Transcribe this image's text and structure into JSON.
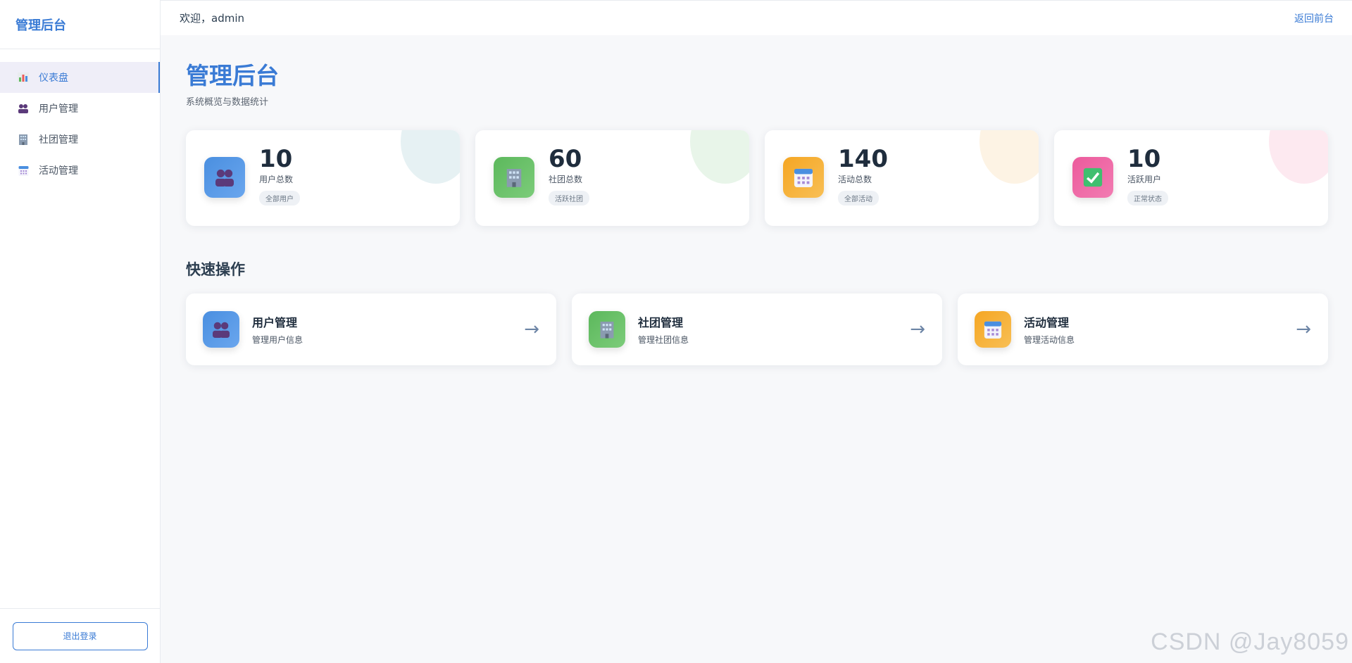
{
  "sidebar": {
    "brand": "管理后台",
    "items": [
      {
        "label": "仪表盘",
        "icon": "bar-chart-icon"
      },
      {
        "label": "用户管理",
        "icon": "users-icon"
      },
      {
        "label": "社团管理",
        "icon": "building-icon"
      },
      {
        "label": "活动管理",
        "icon": "calendar-icon"
      }
    ],
    "logout_label": "退出登录"
  },
  "topbar": {
    "welcome": "欢迎，admin",
    "back_link": "返回前台"
  },
  "main": {
    "title": "管理后台",
    "subtitle": "系统概览与数据统计",
    "stats": [
      {
        "value": "10",
        "label": "用户总数",
        "badge": "全部用户",
        "icon": "users-icon",
        "color": "#4a8fe0",
        "blob": "#e6f1f3"
      },
      {
        "value": "60",
        "label": "社团总数",
        "badge": "活跃社团",
        "icon": "building-icon",
        "color": "#5cb85c",
        "blob": "#e8f5e9"
      },
      {
        "value": "140",
        "label": "活动总数",
        "badge": "全部活动",
        "icon": "calendar-icon",
        "color": "#f5a623",
        "blob": "#fdf3e4"
      },
      {
        "value": "10",
        "label": "活跃用户",
        "badge": "正常状态",
        "icon": "check-icon",
        "color": "#ec5a9c",
        "blob": "#fde9f0"
      }
    ],
    "quick_title": "快速操作",
    "actions": [
      {
        "title": "用户管理",
        "desc": "管理用户信息",
        "icon": "users-icon",
        "arrow": "→"
      },
      {
        "title": "社团管理",
        "desc": "管理社团信息",
        "icon": "building-icon",
        "arrow": "→"
      },
      {
        "title": "活动管理",
        "desc": "管理活动信息",
        "icon": "calendar-icon",
        "arrow": "→"
      }
    ]
  },
  "watermark": "CSDN @Jay8059"
}
